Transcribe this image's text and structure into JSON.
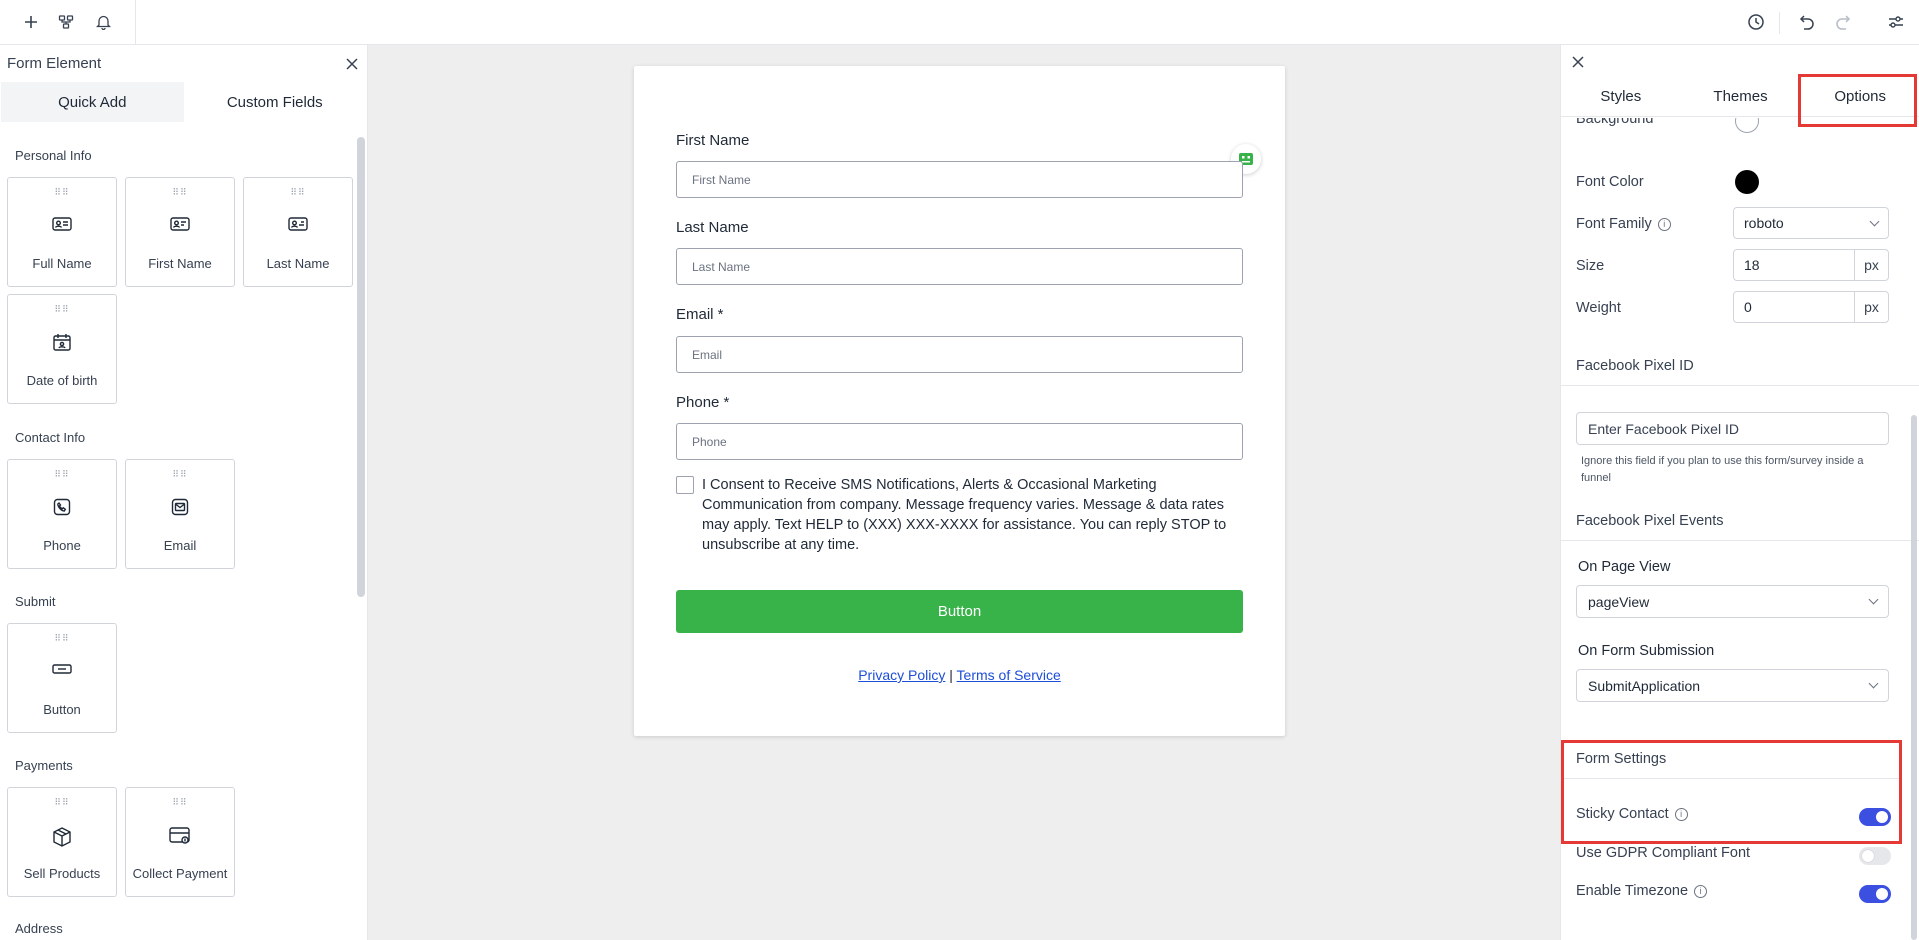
{
  "left_panel": {
    "title": "Form Element",
    "tabs": [
      "Quick Add",
      "Custom Fields"
    ],
    "sections": {
      "personal": "Personal Info",
      "contact": "Contact Info",
      "submit": "Submit",
      "payments": "Payments",
      "address": "Address"
    },
    "cards": {
      "full_name": "Full Name",
      "first_name": "First Name",
      "last_name": "Last Name",
      "dob": "Date of birth",
      "phone": "Phone",
      "email": "Email",
      "button": "Button",
      "sell_products": "Sell Products",
      "collect_payment": "Collect Payment"
    }
  },
  "form": {
    "first_name_label": "First Name",
    "first_name_placeholder": "First Name",
    "last_name_label": "Last Name",
    "last_name_placeholder": "Last Name",
    "email_label": "Email *",
    "email_placeholder": "Email",
    "phone_label": "Phone *",
    "phone_placeholder": "Phone",
    "consent": "I Consent to Receive SMS Notifications, Alerts & Occasional Marketing Communication from company. Message frequency varies. Message & data rates may apply. Text HELP to (XXX) XXX-XXXX for assistance. You can reply STOP to unsubscribe at any time.",
    "button_label": "Button",
    "privacy": "Privacy Policy",
    "separator": "|",
    "terms": "Terms of Service",
    "button_color": "#37b34a"
  },
  "right_panel": {
    "tabs": [
      "Styles",
      "Themes",
      "Options"
    ],
    "background_label": "Background",
    "font_color_label": "Font Color",
    "font_color": "#000000",
    "font_family_label": "Font Family",
    "font_family_value": "roboto",
    "size_label": "Size",
    "size_value": "18",
    "weight_label": "Weight",
    "weight_value": "0",
    "unit": "px",
    "pixel_id_heading": "Facebook Pixel ID",
    "pixel_id_placeholder": "Enter Facebook Pixel ID",
    "pixel_help": "Ignore this field if you plan to use this form/survey inside a funnel",
    "pixel_events_heading": "Facebook Pixel Events",
    "page_view_label": "On Page View",
    "page_view_value": "pageView",
    "form_submission_label": "On Form Submission",
    "form_submission_value": "SubmitApplication",
    "form_settings_heading": "Form Settings",
    "sticky_contact": "Sticky Contact",
    "gdpr_font": "Use GDPR Compliant Font",
    "enable_timezone": "Enable Timezone",
    "toggle_on_color": "#3b4fe0",
    "highlight_color": "#e53935"
  }
}
